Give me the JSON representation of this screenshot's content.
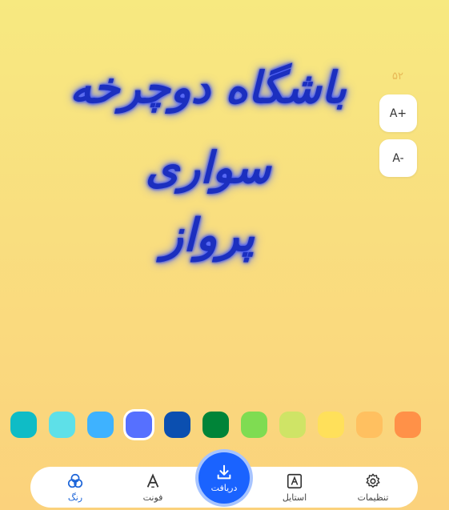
{
  "headline": {
    "line1": "باشگاه دوچرخه سواری",
    "line2": "پرواز",
    "color": "#1b2fbf",
    "glow": "#4f63ff"
  },
  "size_controls": {
    "current_size": "۵۲",
    "increase_label": "A+",
    "decrease_label": "A-"
  },
  "swatches": [
    {
      "color": "#0fbcc6"
    },
    {
      "color": "#5ee0e8"
    },
    {
      "color": "#3eb2ff"
    },
    {
      "color": "#5670ff",
      "selected": true
    },
    {
      "color": "#0b4fb0"
    },
    {
      "color": "#008438"
    },
    {
      "color": "#7fdc52"
    },
    {
      "color": "#cfe466"
    },
    {
      "color": "#ffe05a"
    },
    {
      "color": "#ffc060"
    },
    {
      "color": "#ff9148"
    }
  ],
  "bottom_nav": {
    "color": "رنگ",
    "font": "فونت",
    "download": "دریافت",
    "style": "استایل",
    "settings": "تنظیمات",
    "active_color": "#1a63d8"
  }
}
